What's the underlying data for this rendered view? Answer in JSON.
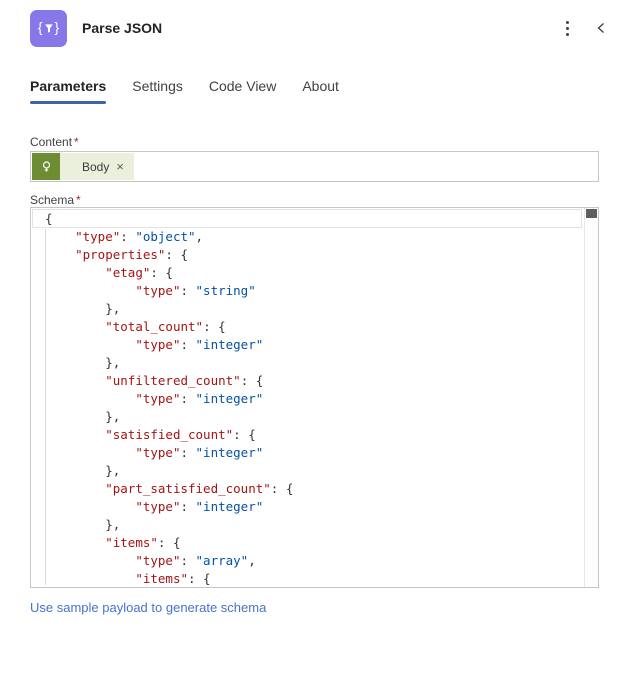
{
  "header": {
    "title": "Parse JSON",
    "icon": "parse-json-icon",
    "icon_braces": {
      "open": "{",
      "close": "}"
    }
  },
  "tabs": [
    {
      "label": "Parameters",
      "active": true
    },
    {
      "label": "Settings",
      "active": false
    },
    {
      "label": "Code View",
      "active": false
    },
    {
      "label": "About",
      "active": false
    }
  ],
  "content_field": {
    "label": "Content",
    "required_mark": "*",
    "token": {
      "label": "Body",
      "remove_glyph": "×",
      "icon": "dynamic-content-connector-icon"
    }
  },
  "schema_field": {
    "label": "Schema",
    "required_mark": "*",
    "code_lines": [
      "{",
      "    \"type\": \"object\",",
      "    \"properties\": {",
      "        \"etag\": {",
      "            \"type\": \"string\"",
      "        },",
      "        \"total_count\": {",
      "            \"type\": \"integer\"",
      "        },",
      "        \"unfiltered_count\": {",
      "            \"type\": \"integer\"",
      "        },",
      "        \"satisfied_count\": {",
      "            \"type\": \"integer\"",
      "        },",
      "        \"part_satisfied_count\": {",
      "            \"type\": \"integer\"",
      "        },",
      "        \"items\": {",
      "            \"type\": \"array\",",
      "            \"items\": {"
    ]
  },
  "footer": {
    "sample_payload_link": "Use sample payload to generate schema"
  },
  "colors": {
    "icon_purple": "#8579e9",
    "tab_underline_blue": "#3e64a6",
    "required_red": "#a4262c",
    "token_icon_green": "#6e8c32",
    "token_pill_green": "#eaf0dc",
    "code_key_red": "#a31515",
    "code_string_blue": "#0451a5",
    "link_blue": "#4673cf"
  }
}
